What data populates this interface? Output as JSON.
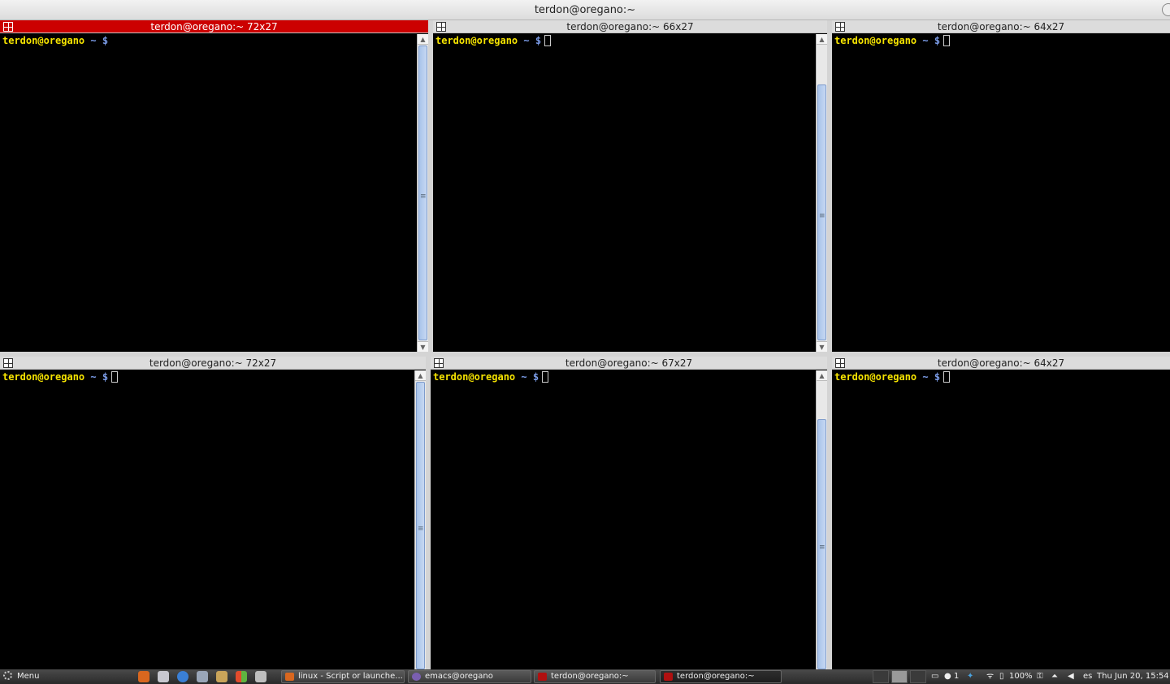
{
  "window": {
    "title": "terdon@oregano:~"
  },
  "panes": [
    {
      "title": "terdon@oregano:~ 72x27",
      "prompt_user": "terdon@oregano",
      "prompt_tail": " ~ $"
    },
    {
      "title": "terdon@oregano:~ 66x27",
      "prompt_user": "terdon@oregano",
      "prompt_tail": " ~ $"
    },
    {
      "title": "terdon@oregano:~ 64x27",
      "prompt_user": "terdon@oregano",
      "prompt_tail": " ~ $"
    },
    {
      "title": "terdon@oregano:~ 72x27",
      "prompt_user": "terdon@oregano",
      "prompt_tail": " ~ $"
    },
    {
      "title": "terdon@oregano:~ 67x27",
      "prompt_user": "terdon@oregano",
      "prompt_tail": " ~ $"
    },
    {
      "title": "terdon@oregano:~ 64x27",
      "prompt_user": "terdon@oregano",
      "prompt_tail": " ~ $"
    }
  ],
  "taskbar": {
    "menu_label": "Menu",
    "launchers": [
      "firefox-icon",
      "files-icon",
      "chrome-icon",
      "network-icon",
      "archive-icon",
      "windows-icon",
      "printer-icon"
    ],
    "tasks": [
      {
        "label": "linux - Script or launche...",
        "icon": "firefox-icon"
      },
      {
        "label": "emacs@oregano",
        "icon": "emacs-icon"
      },
      {
        "label": "terdon@oregano:~",
        "icon": "terminal-icon"
      },
      {
        "label": "terdon@oregano:~",
        "icon": "terminal-icon"
      }
    ],
    "tray": {
      "notifications": "1",
      "battery": "100%",
      "keyboard_layout": "es",
      "clock": "Thu Jun 20, 15:54"
    }
  },
  "colors": {
    "active_title": "#cc0000",
    "prompt_user": "#f5e300",
    "prompt_tail": "#7b9ce8"
  }
}
